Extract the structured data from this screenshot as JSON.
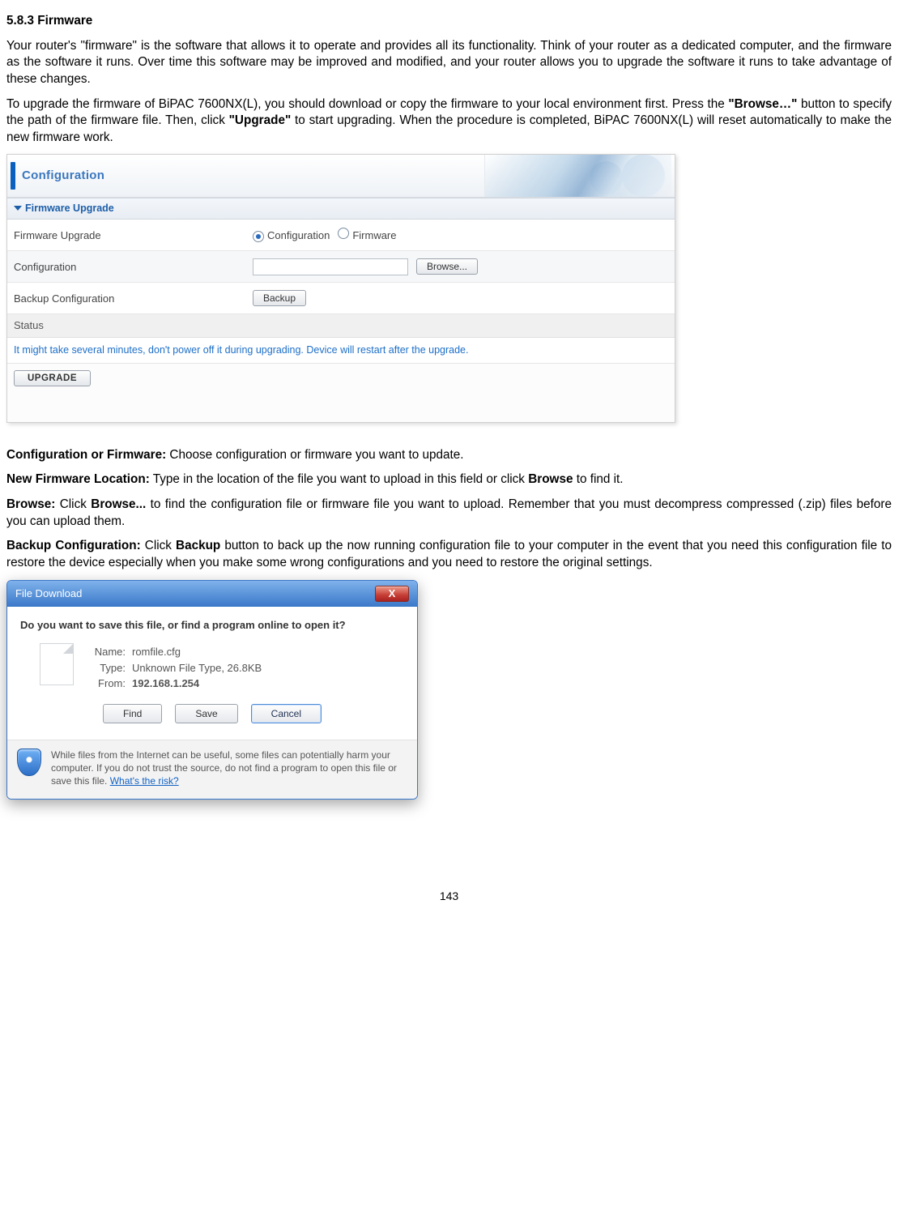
{
  "doc": {
    "section_num": "5.8.3 Firmware",
    "p1": "Your router's \"firmware\" is the software that allows it to operate and provides all its functionality. Think of your router as a dedicated computer, and the firmware as the software it runs. Over time this software may be improved and modified, and your router allows you to upgrade the software it runs to take advantage of these changes.",
    "p2_a": "To upgrade the firmware of BiPAC 7600NX(L), you should download or copy the firmware to your local environment first. Press the ",
    "p2_b": "\"Browse…\"",
    "p2_c": " button to specify the path of the firmware file. Then, click ",
    "p2_d": "\"Upgrade\"",
    "p2_e": " to start upgrading. When the procedure is completed, BiPAC 7600NX(L) will reset automatically to make the new firmware work.",
    "cfg_or_fw_k": "Configuration or Firmware:",
    "cfg_or_fw_v": " Choose configuration or firmware you want to update.",
    "new_fw_k": "New Firmware Location:",
    "new_fw_v_a": " Type in the location of the file you want to upload in this field or click ",
    "new_fw_v_b": "Browse",
    "new_fw_v_c": " to find it.",
    "browse_k": "Browse:",
    "browse_v_a": " Click ",
    "browse_v_b": "Browse...",
    "browse_v_c": " to find the configuration file or firmware file you want to upload. Remember that you must decompress compressed (.zip) files before you can upload them.",
    "backup_k": "Backup Configuration:",
    "backup_v_a": " Click ",
    "backup_v_b": "Backup",
    "backup_v_c": " button to back up the now running configuration file to your computer in the event that you need this configuration file to restore the device especially when you make some wrong configurations and you need to restore the original settings.",
    "page_num": "143"
  },
  "panel": {
    "title": "Configuration",
    "section": "Firmware Upgrade",
    "rows": {
      "r1_label": "Firmware Upgrade",
      "r1_opt_a": "Configuration",
      "r1_opt_b": "Firmware",
      "r2_label": "Configuration",
      "r2_browse": "Browse...",
      "r3_label": "Backup Configuration",
      "r3_backup": "Backup",
      "r4_label": "Status"
    },
    "note": "It might take several minutes, don't power off it during upgrading. Device will restart after the upgrade.",
    "upgrade": "UPGRADE"
  },
  "dialog": {
    "title": "File Download",
    "close": "X",
    "question": "Do you want to save this file, or find a program online to open it?",
    "name_k": "Name:",
    "name_v": "romfile.cfg",
    "type_k": "Type:",
    "type_v": "Unknown File Type, 26.8KB",
    "from_k": "From:",
    "from_v": "192.168.1.254",
    "btn_find": "Find",
    "btn_save": "Save",
    "btn_cancel": "Cancel",
    "warn": "While files from the Internet can be useful, some files can potentially harm your computer. If you do not trust the source, do not find a program to open this file or save this file. ",
    "risk": "What's the risk?"
  }
}
